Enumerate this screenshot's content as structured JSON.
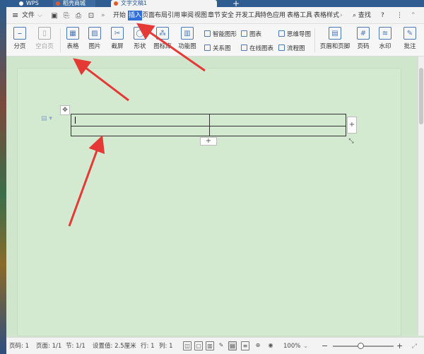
{
  "tabs": {
    "wps": "WPS",
    "doc2": "稻壳商城",
    "doc": "文字文稿1",
    "new_tab": "+"
  },
  "menubar": {
    "menu_icon": "≡",
    "file": "文件",
    "items": [
      "开始",
      "插入",
      "页面布局",
      "引用",
      "审阅",
      "视图",
      "章节",
      "安全",
      "开发工具",
      "特色应用",
      "表格工具",
      "表格样式"
    ],
    "more": "›",
    "search": "查找",
    "help": "?",
    "options": "⋮"
  },
  "ribbon": {
    "page_break": "分页",
    "blank_page": "空白页",
    "table": "表格",
    "picture": "图片",
    "screenshot": "截屏",
    "shapes": "形状",
    "icon_lib": "图标库",
    "func_chart": "功能图",
    "smart_graphic": "智能图形",
    "chart": "图表",
    "mind_map": "思维导图",
    "relation": "关系图",
    "online_chart": "在线图表",
    "flowchart": "流程图",
    "header_footer": "页眉和页脚",
    "page_num": "页码",
    "watermark": "水印",
    "comment": "批注"
  },
  "document": {
    "add_col": "+",
    "add_row": "+",
    "move": "✥",
    "resize": "⤡"
  },
  "statusbar": {
    "page": "页码: 1",
    "pages": "页面: 1/1",
    "section": "节: 1/1",
    "setting": "设置值: 2.5厘米",
    "row": "行: 1",
    "col": "列: 1",
    "zoom": "100%",
    "zoom_out": "−",
    "zoom_in": "+"
  },
  "colors": {
    "accent": "#2f6fd6",
    "page_bg": "#d3ead1",
    "arrow": "#e53935"
  }
}
